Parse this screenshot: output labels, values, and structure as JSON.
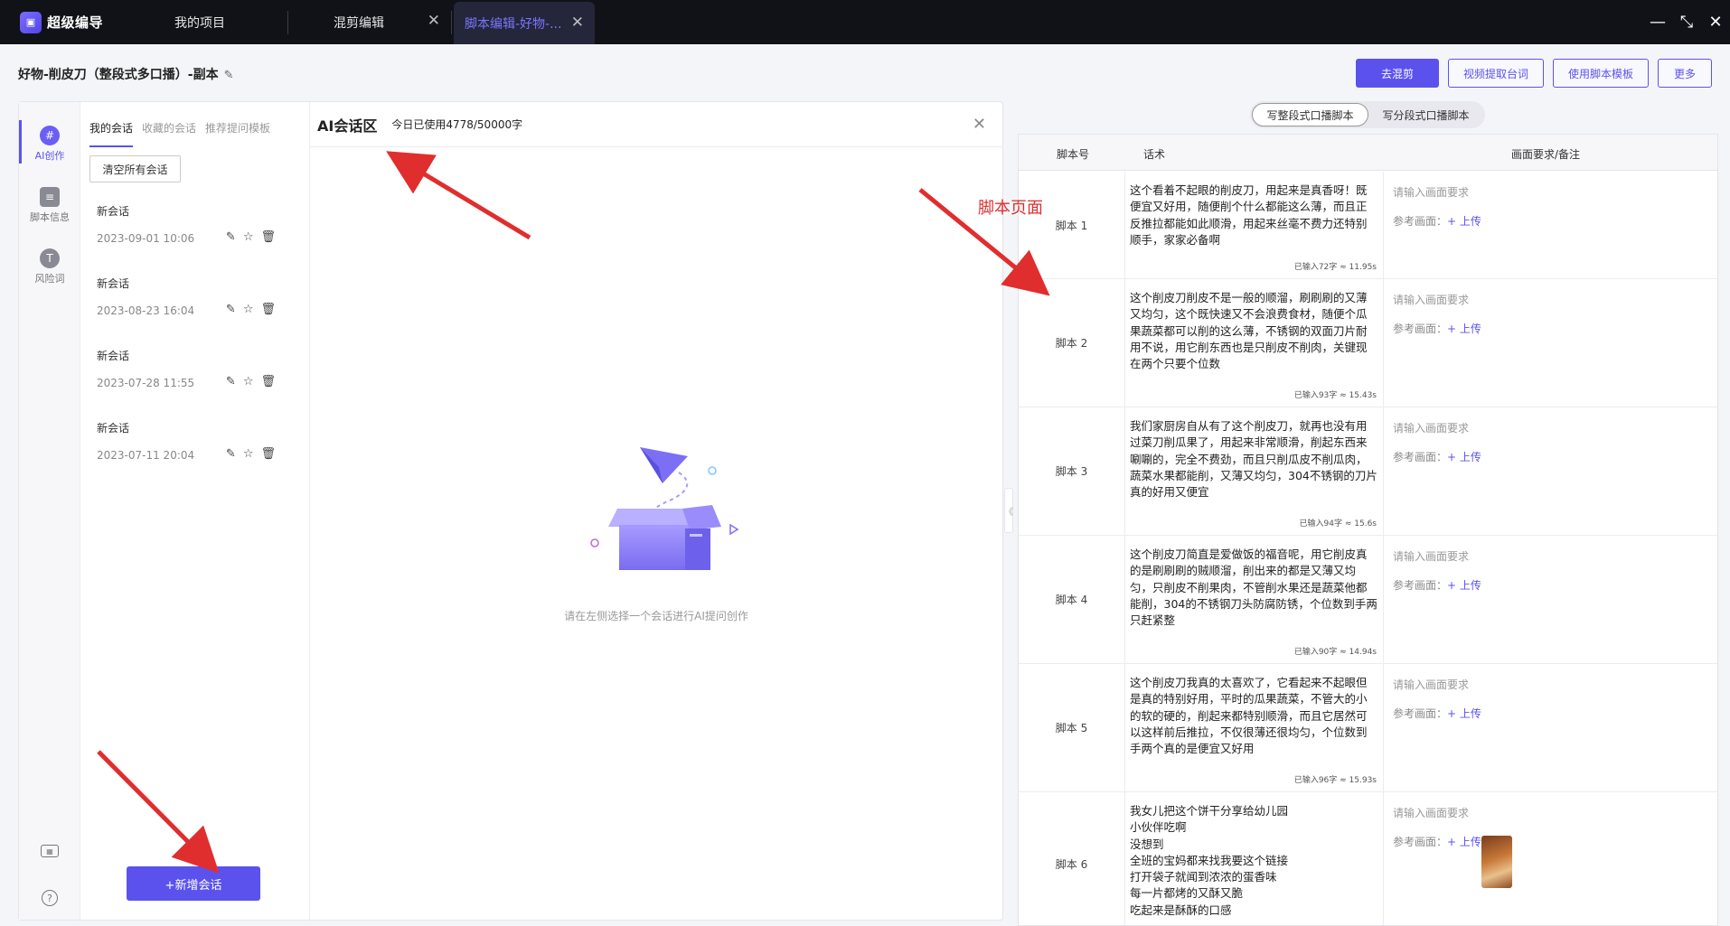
{
  "app": {
    "name": "超级编导"
  },
  "tabs": [
    {
      "label": "我的项目"
    },
    {
      "label": "混剪编辑"
    },
    {
      "label": "脚本编辑-好物-..."
    }
  ],
  "document": {
    "title": "好物-削皮刀（整段式多口播）-副本"
  },
  "actions": {
    "mix": "去混剪",
    "extract": "视频提取台词",
    "template": "使用脚本模板",
    "more": "更多"
  },
  "sidebar": {
    "ai": "AI创作",
    "info": "脚本信息",
    "risk": "风险词"
  },
  "conversations": {
    "tabs": [
      "我的会话",
      "收藏的会话",
      "推荐提问模板"
    ],
    "clear": "清空所有会话",
    "items": [
      {
        "title": "新会话",
        "date": "2023-09-01 10:06"
      },
      {
        "title": "新会话",
        "date": "2023-08-23 16:04"
      },
      {
        "title": "新会话",
        "date": "2023-07-28 11:55"
      },
      {
        "title": "新会话",
        "date": "2023-07-11 20:04"
      }
    ],
    "new": "+新增会话"
  },
  "chat": {
    "title": "AI会话区",
    "usage": "今日已使用4778/50000字",
    "empty": "请在左侧选择一个会话进行AI提问创作"
  },
  "mode": {
    "whole": "写整段式口播脚本",
    "split": "写分段式口播脚本"
  },
  "table": {
    "headers": {
      "no": "脚本号",
      "speech": "话术",
      "note": "画面要求/备注"
    },
    "placeholder": "请输入画面要求",
    "ref_label": "参考画面：",
    "upload": "+ 上传",
    "rows": [
      {
        "no": "脚本 1",
        "text": "这个看着不起眼的削皮刀，用起来是真香呀！既便宜又好用，随便削个什么都能这么薄，而且正反推拉都能如此顺滑，用起来丝毫不费力还特别顺手，家家必备啊",
        "count": "已输入72字 ≈ 11.95s"
      },
      {
        "no": "脚本 2",
        "text": "这个削皮刀削皮不是一般的顺溜，刷刷刷的又薄又均匀，这个既快速又不会浪费食材，随便个瓜果蔬菜都可以削的这么薄，不锈钢的双面刀片耐用不说，用它削东西也是只削皮不削肉，关键现在两个只要个位数",
        "count": "已输入93字 ≈ 15.43s"
      },
      {
        "no": "脚本 3",
        "text": "我们家厨房自从有了这个削皮刀，就再也没有用过菜刀削瓜果了，用起来非常顺滑，削起东西来唰唰的，完全不费劲，而且只削瓜皮不削瓜肉，蔬菜水果都能削，又薄又均匀，304不锈钢的刀片真的好用又便宜",
        "count": "已输入94字 ≈ 15.6s"
      },
      {
        "no": "脚本 4",
        "text": "这个削皮刀简直是爱做饭的福音呢，用它削皮真的是刷刷刷的贼顺溜，削出来的都是又薄又均匀，只削皮不削果肉，不管削水果还是蔬菜他都能削，304的不锈钢刀头防腐防锈，个位数到手两只赶紧整",
        "count": "已输入90字 ≈ 14.94s"
      },
      {
        "no": "脚本 5",
        "text": "这个削皮刀我真的太喜欢了，它看起来不起眼但是真的特别好用，平时的瓜果蔬菜，不管大的小的软的硬的，削起来都特别顺滑，而且它居然可以这样前后推拉，不仅很薄还很均匀，个位数到手两个真的是便宜又好用",
        "count": "已输入96字 ≈ 15.93s"
      },
      {
        "no": "脚本 6",
        "text": "我女儿把这个饼干分享给幼儿园\n小伙伴吃啊\n没想到\n全班的宝妈都来找我要这个链接\n打开袋子就闻到浓浓的蛋香味\n每一片都烤的又酥又脆\n吃起来是酥酥的口感",
        "count": ""
      }
    ]
  },
  "annotation": {
    "label": "脚本页面"
  },
  "colors": {
    "accent": "#5b52ee",
    "titlebar": "#111217",
    "arrow": "#e02e2e"
  }
}
